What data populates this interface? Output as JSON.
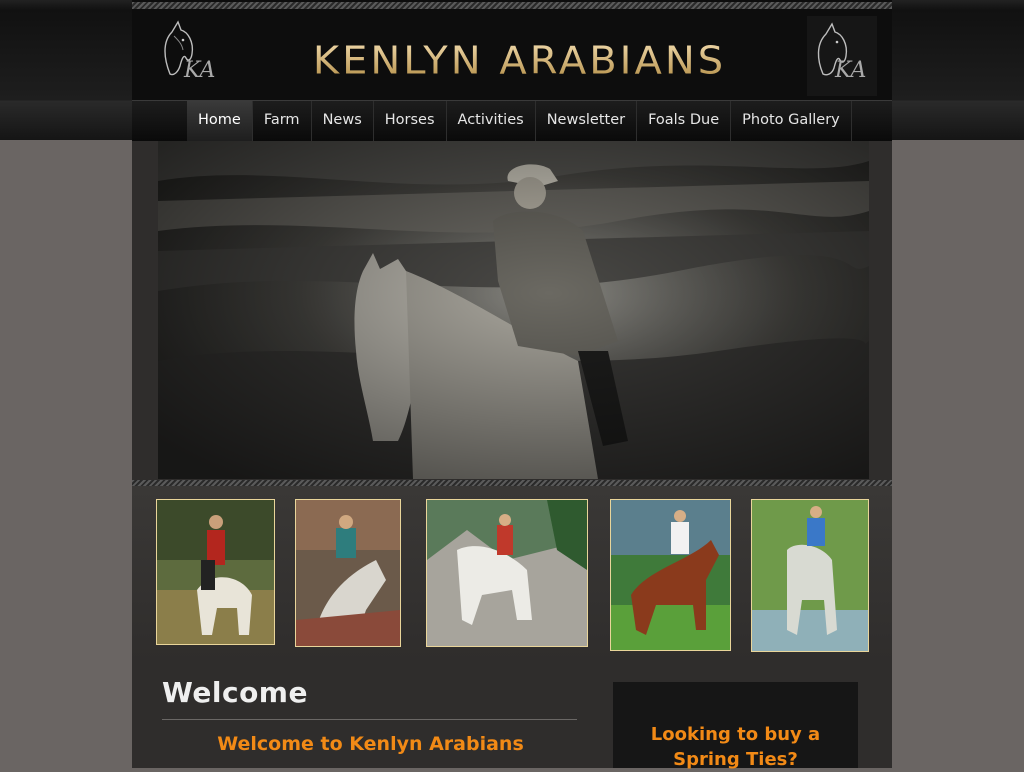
{
  "site": {
    "brand_title": "KENLYN ARABIANS",
    "logo_monogram": "KA"
  },
  "nav": {
    "items": [
      {
        "label": "Home",
        "active": true
      },
      {
        "label": "Farm",
        "active": false
      },
      {
        "label": "News",
        "active": false
      },
      {
        "label": "Horses",
        "active": false
      },
      {
        "label": "Activities",
        "active": false
      },
      {
        "label": "Newsletter",
        "active": false
      },
      {
        "label": "Foals Due",
        "active": false
      },
      {
        "label": "Photo Gallery",
        "active": false
      }
    ]
  },
  "hero": {
    "icon": "hero-photo-rider-on-horse"
  },
  "gallery": {
    "thumbnails": [
      {
        "icon": "thumbnail-photo-rider-1"
      },
      {
        "icon": "thumbnail-photo-rider-2"
      },
      {
        "icon": "thumbnail-photo-rider-3"
      },
      {
        "icon": "thumbnail-photo-rider-4"
      },
      {
        "icon": "thumbnail-photo-rider-5"
      }
    ]
  },
  "welcome": {
    "heading": "Welcome",
    "subheading": "Welcome to Kenlyn Arabians"
  },
  "promo": {
    "line1": "Looking to buy a",
    "line2": "Spring Ties?"
  },
  "colors": {
    "accent_orange": "#f28a16",
    "gold": "#d9b76b",
    "background": "#6a6563",
    "content_bg": "#2f2d2c"
  }
}
